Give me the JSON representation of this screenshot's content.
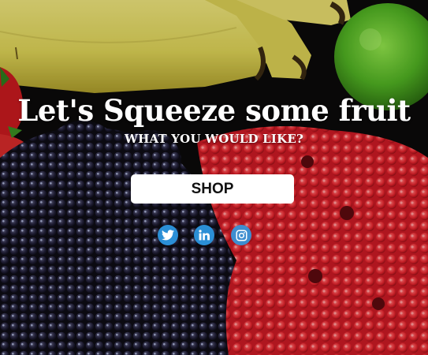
{
  "hero": {
    "headline": "Let's Squeeze some fruit",
    "subheadline": "WHAT YOU WOULD LIKE?",
    "shop_label": "SHOP"
  },
  "social": {
    "icons": [
      "twitter-icon",
      "linkedin-icon",
      "instagram-icon"
    ],
    "accent_color": "#2b8fd6"
  },
  "background": {
    "fruits": [
      "banana",
      "lime",
      "blackberry",
      "raspberry",
      "strawberry"
    ]
  }
}
